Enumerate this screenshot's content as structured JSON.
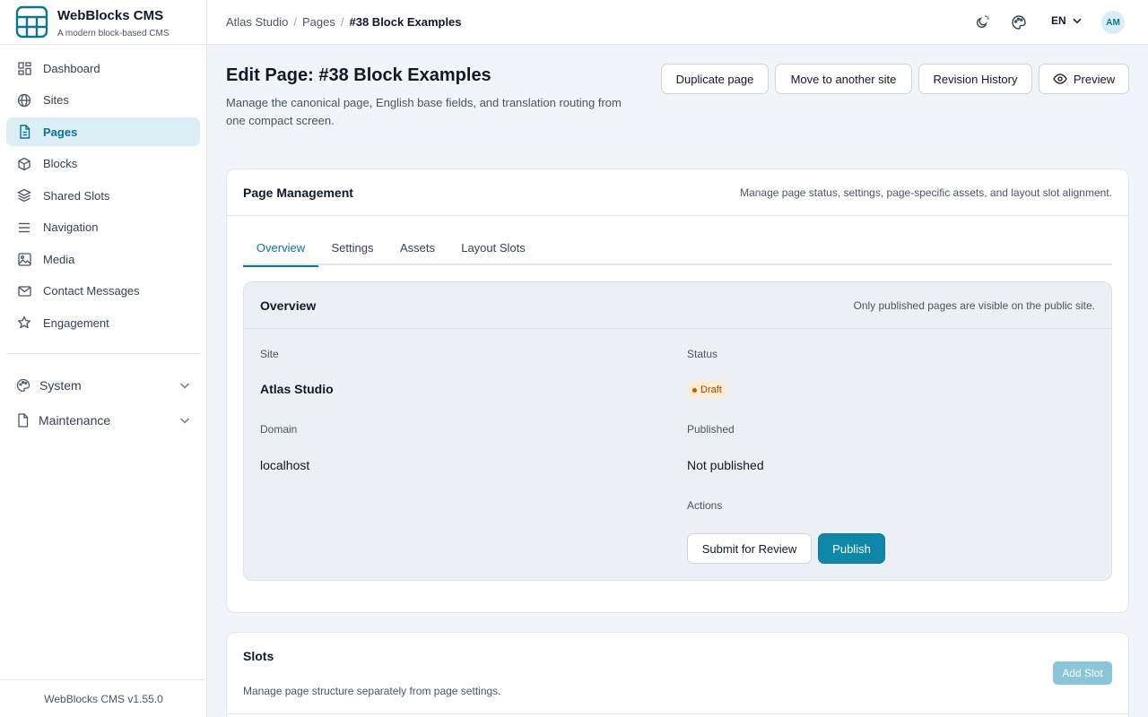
{
  "brand": {
    "name": "WebBlocks CMS",
    "tagline": "A modern block-based CMS"
  },
  "sidebar": {
    "items": [
      {
        "label": "Dashboard",
        "icon": "dashboard-icon"
      },
      {
        "label": "Sites",
        "icon": "globe-icon"
      },
      {
        "label": "Pages",
        "icon": "document-icon",
        "active": true
      },
      {
        "label": "Blocks",
        "icon": "cube-icon"
      },
      {
        "label": "Shared Slots",
        "icon": "layers-icon"
      },
      {
        "label": "Navigation",
        "icon": "menu-icon"
      },
      {
        "label": "Media",
        "icon": "image-icon"
      },
      {
        "label": "Contact Messages",
        "icon": "mail-icon"
      },
      {
        "label": "Engagement",
        "icon": "star-icon"
      }
    ],
    "groups": [
      {
        "label": "System",
        "icon": "palette-icon"
      },
      {
        "label": "Maintenance",
        "icon": "file-icon"
      }
    ],
    "footer": "WebBlocks CMS v1.55.0"
  },
  "topbar": {
    "breadcrumb": [
      "Atlas Studio",
      "Pages",
      "#38 Block Examples"
    ],
    "separator": "/",
    "language": "EN",
    "avatar_initials": "AM"
  },
  "header": {
    "title": "Edit Page: #38 Block Examples",
    "subtitle": "Manage the canonical page, English base fields, and translation routing from one compact screen.",
    "actions": {
      "duplicate": "Duplicate page",
      "move": "Move to another site",
      "revisions": "Revision History",
      "preview": "Preview"
    }
  },
  "management": {
    "title": "Page Management",
    "description": "Manage page status, settings, page-specific assets, and layout slot alignment.",
    "tabs": [
      "Overview",
      "Settings",
      "Assets",
      "Layout Slots"
    ],
    "active_tab": "Overview",
    "overview": {
      "title": "Overview",
      "note": "Only published pages are visible on the public site.",
      "site_label": "Site",
      "site_value": "Atlas Studio",
      "status_label": "Status",
      "status_value": "Draft",
      "domain_label": "Domain",
      "domain_value": "localhost",
      "published_label": "Published",
      "published_value": "Not published",
      "actions_label": "Actions",
      "submit_label": "Submit for Review",
      "publish_label": "Publish"
    }
  },
  "slots": {
    "title": "Slots",
    "description": "Manage page structure separately from page settings.",
    "add_label": "Add Slot"
  },
  "colors": {
    "accent": "#0e7490",
    "primary_button": "#0e87a8",
    "active_nav_bg": "#dbeef5",
    "draft_badge_bg": "#fdecd0",
    "page_bg": "#f1f4f8"
  }
}
